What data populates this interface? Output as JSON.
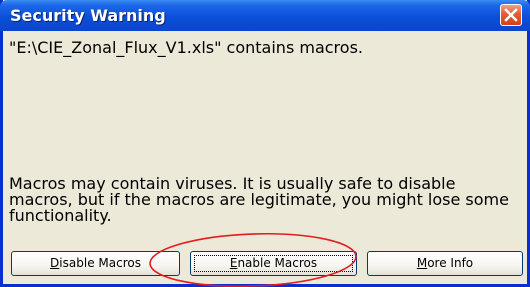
{
  "window": {
    "title": "Security Warning"
  },
  "message": {
    "file_line": "\"E:\\CIE_Zonal_Flux_V1.xls\" contains macros.",
    "warning_line": "Macros may contain viruses. It is usually safe to disable macros, but if the macros are legitimate, you might lose some functionality."
  },
  "buttons": {
    "disable": {
      "mnemonic": "D",
      "rest": "isable Macros"
    },
    "enable": {
      "mnemonic": "E",
      "rest": "nable Macros"
    },
    "more_info": {
      "mnemonic": "M",
      "rest": "ore Info"
    }
  },
  "colors": {
    "title_bar": "#0b4fd9",
    "window_bg": "#ece9d8",
    "close_button": "#e35d33",
    "annotation_circle": "#e31c1c"
  }
}
